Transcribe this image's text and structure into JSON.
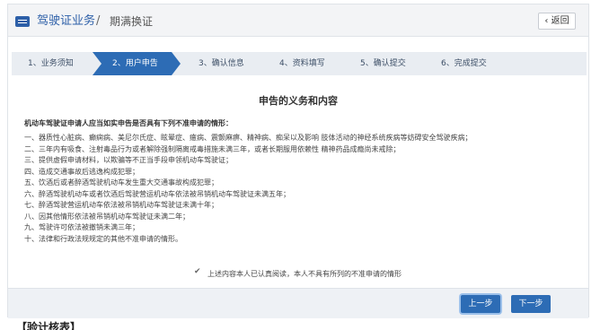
{
  "header": {
    "title": "驾驶证业务",
    "separator": "/",
    "subtitle": "期满换证",
    "back_label": "返回"
  },
  "steps": [
    {
      "label": "1、业务须知",
      "active": false
    },
    {
      "label": "2、用户申告",
      "active": true
    },
    {
      "label": "3、确认信息",
      "active": false
    },
    {
      "label": "4、资料填写",
      "active": false
    },
    {
      "label": "5、确认提交",
      "active": false
    },
    {
      "label": "6、完成提交",
      "active": false
    }
  ],
  "main": {
    "title": "申告的义务和内容",
    "intro": "机动车驾驶证申请人应当如实申告是否具有下列不准申请的情形：",
    "items": [
      "一、器质性心脏病、癫痫病、美尼尔氏症、眩晕症、癔病、震颤麻痹、精神病、痴呆以及影响 肢体活动的神经系统疾病等妨碍安全驾驶疾病；",
      "二、三年内有吸食、注射毒品行为或者解除强制隔离戒毒措施未满三年，或者长期服用依赖性 精神药品成瘾尚未戒除；",
      "三、提供虚假申请材料，以欺骗等不正当手段申领机动车驾驶证；",
      "四、造成交通事故后逃逸构成犯罪；",
      "五、饮酒后或者醉酒驾驶机动车发生重大交通事故构成犯罪；",
      "六、醉酒驾驶机动车或者饮酒后驾驶营运机动车依法被吊销机动车驾驶证未满五年；",
      "七、醉酒驾驶营运机动车依法被吊销机动车驾驶证未满十年；",
      "八、因其他情形依法被吊销机动车驾驶证未满二年；",
      "九、驾驶许可依法被撤销未满三年；",
      "十、法律和行政法规规定的其他不准申请的情形。"
    ],
    "agree_text": "上述内容本人已认真阅读，本人不具有所列的不准申请的情形",
    "agree_checked": true
  },
  "footer": {
    "prev_label": "上一步",
    "next_label": "下一步"
  },
  "bottom_text": "【验计核表】"
}
